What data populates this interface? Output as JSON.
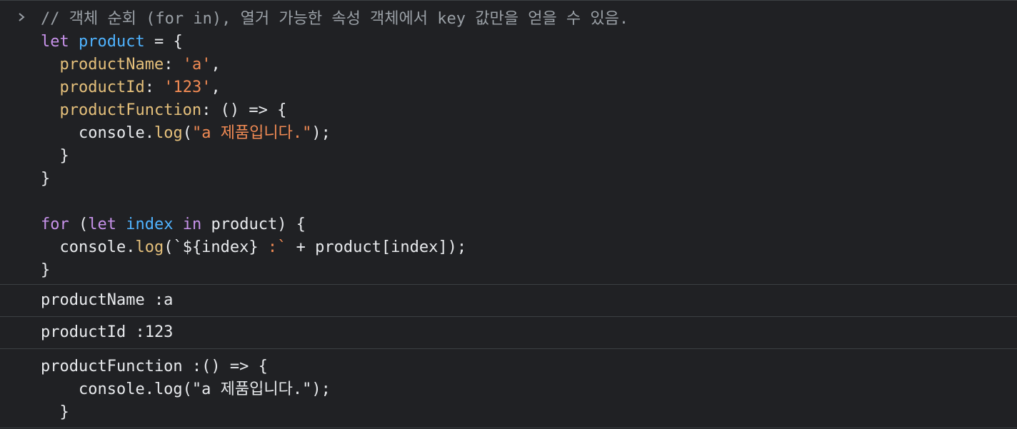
{
  "console": {
    "prompt_icon": "chevron-right-icon",
    "input_lines": [
      [
        {
          "t": "// 객체 순회 (for in), 열거 가능한 속성 객체에서 key 값만을 얻을 수 있음.",
          "c": "comment"
        }
      ],
      [
        {
          "t": "let ",
          "c": "kw"
        },
        {
          "t": "product",
          "c": "var"
        },
        {
          "t": " = {",
          "c": "plain"
        }
      ],
      [
        {
          "t": "  ",
          "c": "plain"
        },
        {
          "t": "productName",
          "c": "prop"
        },
        {
          "t": ": ",
          "c": "plain"
        },
        {
          "t": "'a'",
          "c": "str"
        },
        {
          "t": ",",
          "c": "plain"
        }
      ],
      [
        {
          "t": "  ",
          "c": "plain"
        },
        {
          "t": "productId",
          "c": "prop"
        },
        {
          "t": ": ",
          "c": "plain"
        },
        {
          "t": "'123'",
          "c": "str"
        },
        {
          "t": ",",
          "c": "plain"
        }
      ],
      [
        {
          "t": "  ",
          "c": "plain"
        },
        {
          "t": "productFunction",
          "c": "prop"
        },
        {
          "t": ": () => {",
          "c": "plain"
        }
      ],
      [
        {
          "t": "    console.",
          "c": "plain"
        },
        {
          "t": "log",
          "c": "fn"
        },
        {
          "t": "(",
          "c": "plain"
        },
        {
          "t": "\"a 제품입니다.\"",
          "c": "str"
        },
        {
          "t": ");",
          "c": "plain"
        }
      ],
      [
        {
          "t": "  }",
          "c": "plain"
        }
      ],
      [
        {
          "t": "}",
          "c": "plain"
        }
      ],
      [
        {
          "t": "",
          "c": "plain"
        }
      ],
      [
        {
          "t": "for",
          "c": "kw"
        },
        {
          "t": " (",
          "c": "plain"
        },
        {
          "t": "let",
          "c": "kw"
        },
        {
          "t": " ",
          "c": "plain"
        },
        {
          "t": "index",
          "c": "var"
        },
        {
          "t": " ",
          "c": "plain"
        },
        {
          "t": "in",
          "c": "kw"
        },
        {
          "t": " product) {",
          "c": "plain"
        }
      ],
      [
        {
          "t": "  console.",
          "c": "plain"
        },
        {
          "t": "log",
          "c": "fn"
        },
        {
          "t": "(`${index} ",
          "c": "plain"
        },
        {
          "t": ":`",
          "c": "str"
        },
        {
          "t": " + product[index]);",
          "c": "plain"
        }
      ],
      [
        {
          "t": "}",
          "c": "plain"
        }
      ]
    ],
    "outputs": [
      {
        "text": "productName :a"
      },
      {
        "text": "productId :123"
      }
    ],
    "output_multiline": {
      "lines": [
        "productFunction :() => {",
        "    console.log(\"a 제품입니다.\");",
        "  }"
      ]
    }
  }
}
